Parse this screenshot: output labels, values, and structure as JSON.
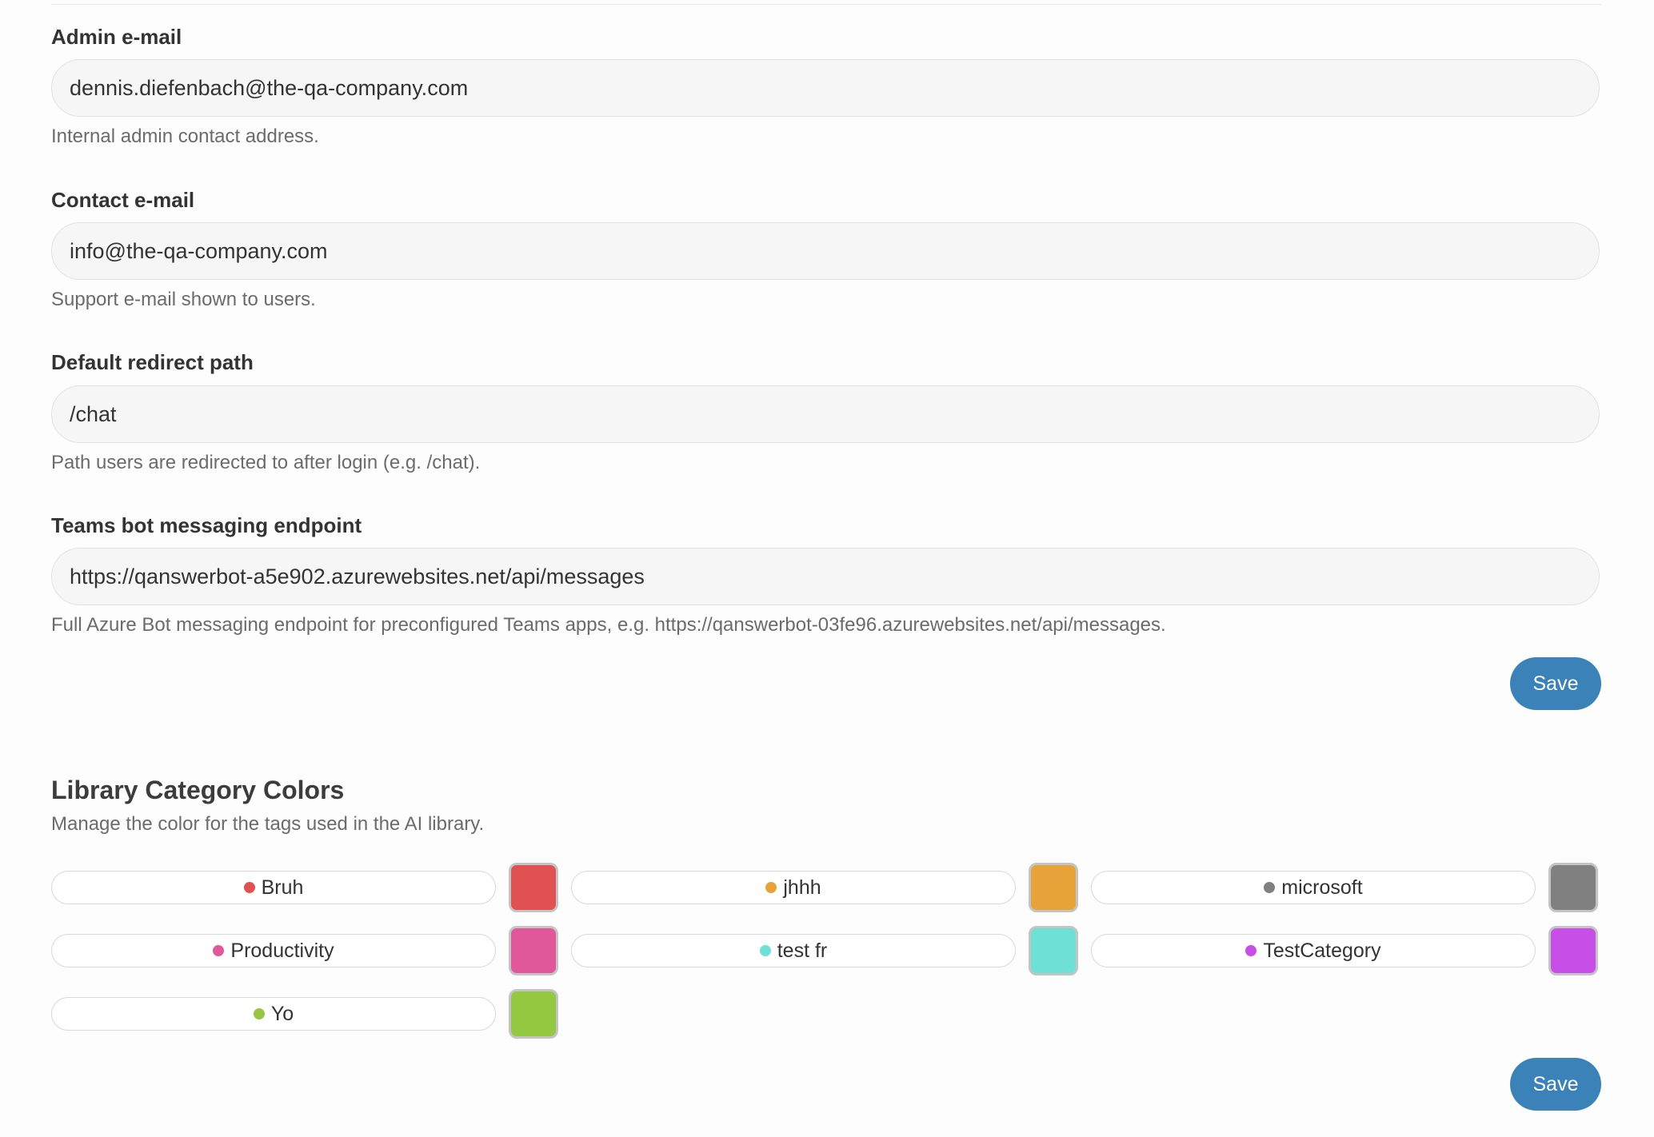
{
  "fields": [
    {
      "label": "Admin e-mail",
      "value": "dennis.diefenbach@the-qa-company.com",
      "help": "Internal admin contact address."
    },
    {
      "label": "Contact e-mail",
      "value": "info@the-qa-company.com",
      "help": "Support e-mail shown to users."
    },
    {
      "label": "Default redirect path",
      "value": "/chat",
      "help": "Path users are redirected to after login (e.g. /chat)."
    },
    {
      "label": "Teams bot messaging endpoint",
      "value": "https://qanswerbot-a5e902.azurewebsites.net/api/messages",
      "help": "Full Azure Bot messaging endpoint for preconfigured Teams apps, e.g. https://qanswerbot-03fe96.azurewebsites.net/api/messages."
    }
  ],
  "settings_save_label": "Save",
  "library": {
    "title": "Library Category Colors",
    "description": "Manage the color for the tags used in the AI library.",
    "save_label": "Save",
    "tags": [
      {
        "name": "Bruh",
        "color": "#e05252"
      },
      {
        "name": "jhhh",
        "color": "#e8a23a"
      },
      {
        "name": "microsoft",
        "color": "#808080"
      },
      {
        "name": "Productivity",
        "color": "#e0579a"
      },
      {
        "name": "test fr",
        "color": "#6fe0d6"
      },
      {
        "name": "TestCategory",
        "color": "#c84ee8"
      },
      {
        "name": "Yo",
        "color": "#94c840"
      }
    ]
  }
}
